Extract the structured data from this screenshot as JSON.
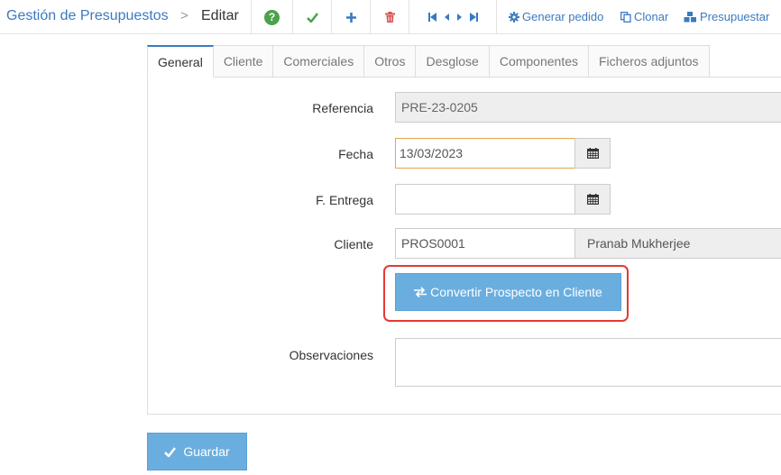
{
  "header": {
    "module_title": "Gestión de Presupuestos",
    "separator": ">",
    "current_page": "Editar"
  },
  "toolbar": {
    "help_label": "?",
    "save_icon": "check-icon",
    "add_icon": "plus-icon",
    "delete_icon": "trash-icon",
    "generar_pedido_label": "Generar pedido",
    "clonar_label": "Clonar",
    "presupuestar_label": "Presupuestar"
  },
  "tabs": [
    {
      "label": "General",
      "active": true
    },
    {
      "label": "Cliente",
      "active": false
    },
    {
      "label": "Comerciales",
      "active": false
    },
    {
      "label": "Otros",
      "active": false
    },
    {
      "label": "Desglose",
      "active": false
    },
    {
      "label": "Componentes",
      "active": false
    },
    {
      "label": "Ficheros adjuntos",
      "active": false
    }
  ],
  "form": {
    "referencia_label": "Referencia",
    "referencia_value": "PRE-23-0205",
    "fecha_label": "Fecha",
    "fecha_value": "13/03/2023",
    "entrega_label": "F. Entrega",
    "entrega_value": "",
    "cliente_label": "Cliente",
    "cliente_code": "PROS0001",
    "cliente_name": "Pranab Mukherjee",
    "convert_label": "Convertir Prospecto en Cliente",
    "observaciones_label": "Observaciones",
    "observaciones_value": ""
  },
  "footer": {
    "save_label": "Guardar"
  },
  "colors": {
    "accent": "#3a7abf",
    "button": "#6aaee0",
    "success": "#4ba24b",
    "danger": "#d9534f",
    "highlight": "#e53935"
  }
}
